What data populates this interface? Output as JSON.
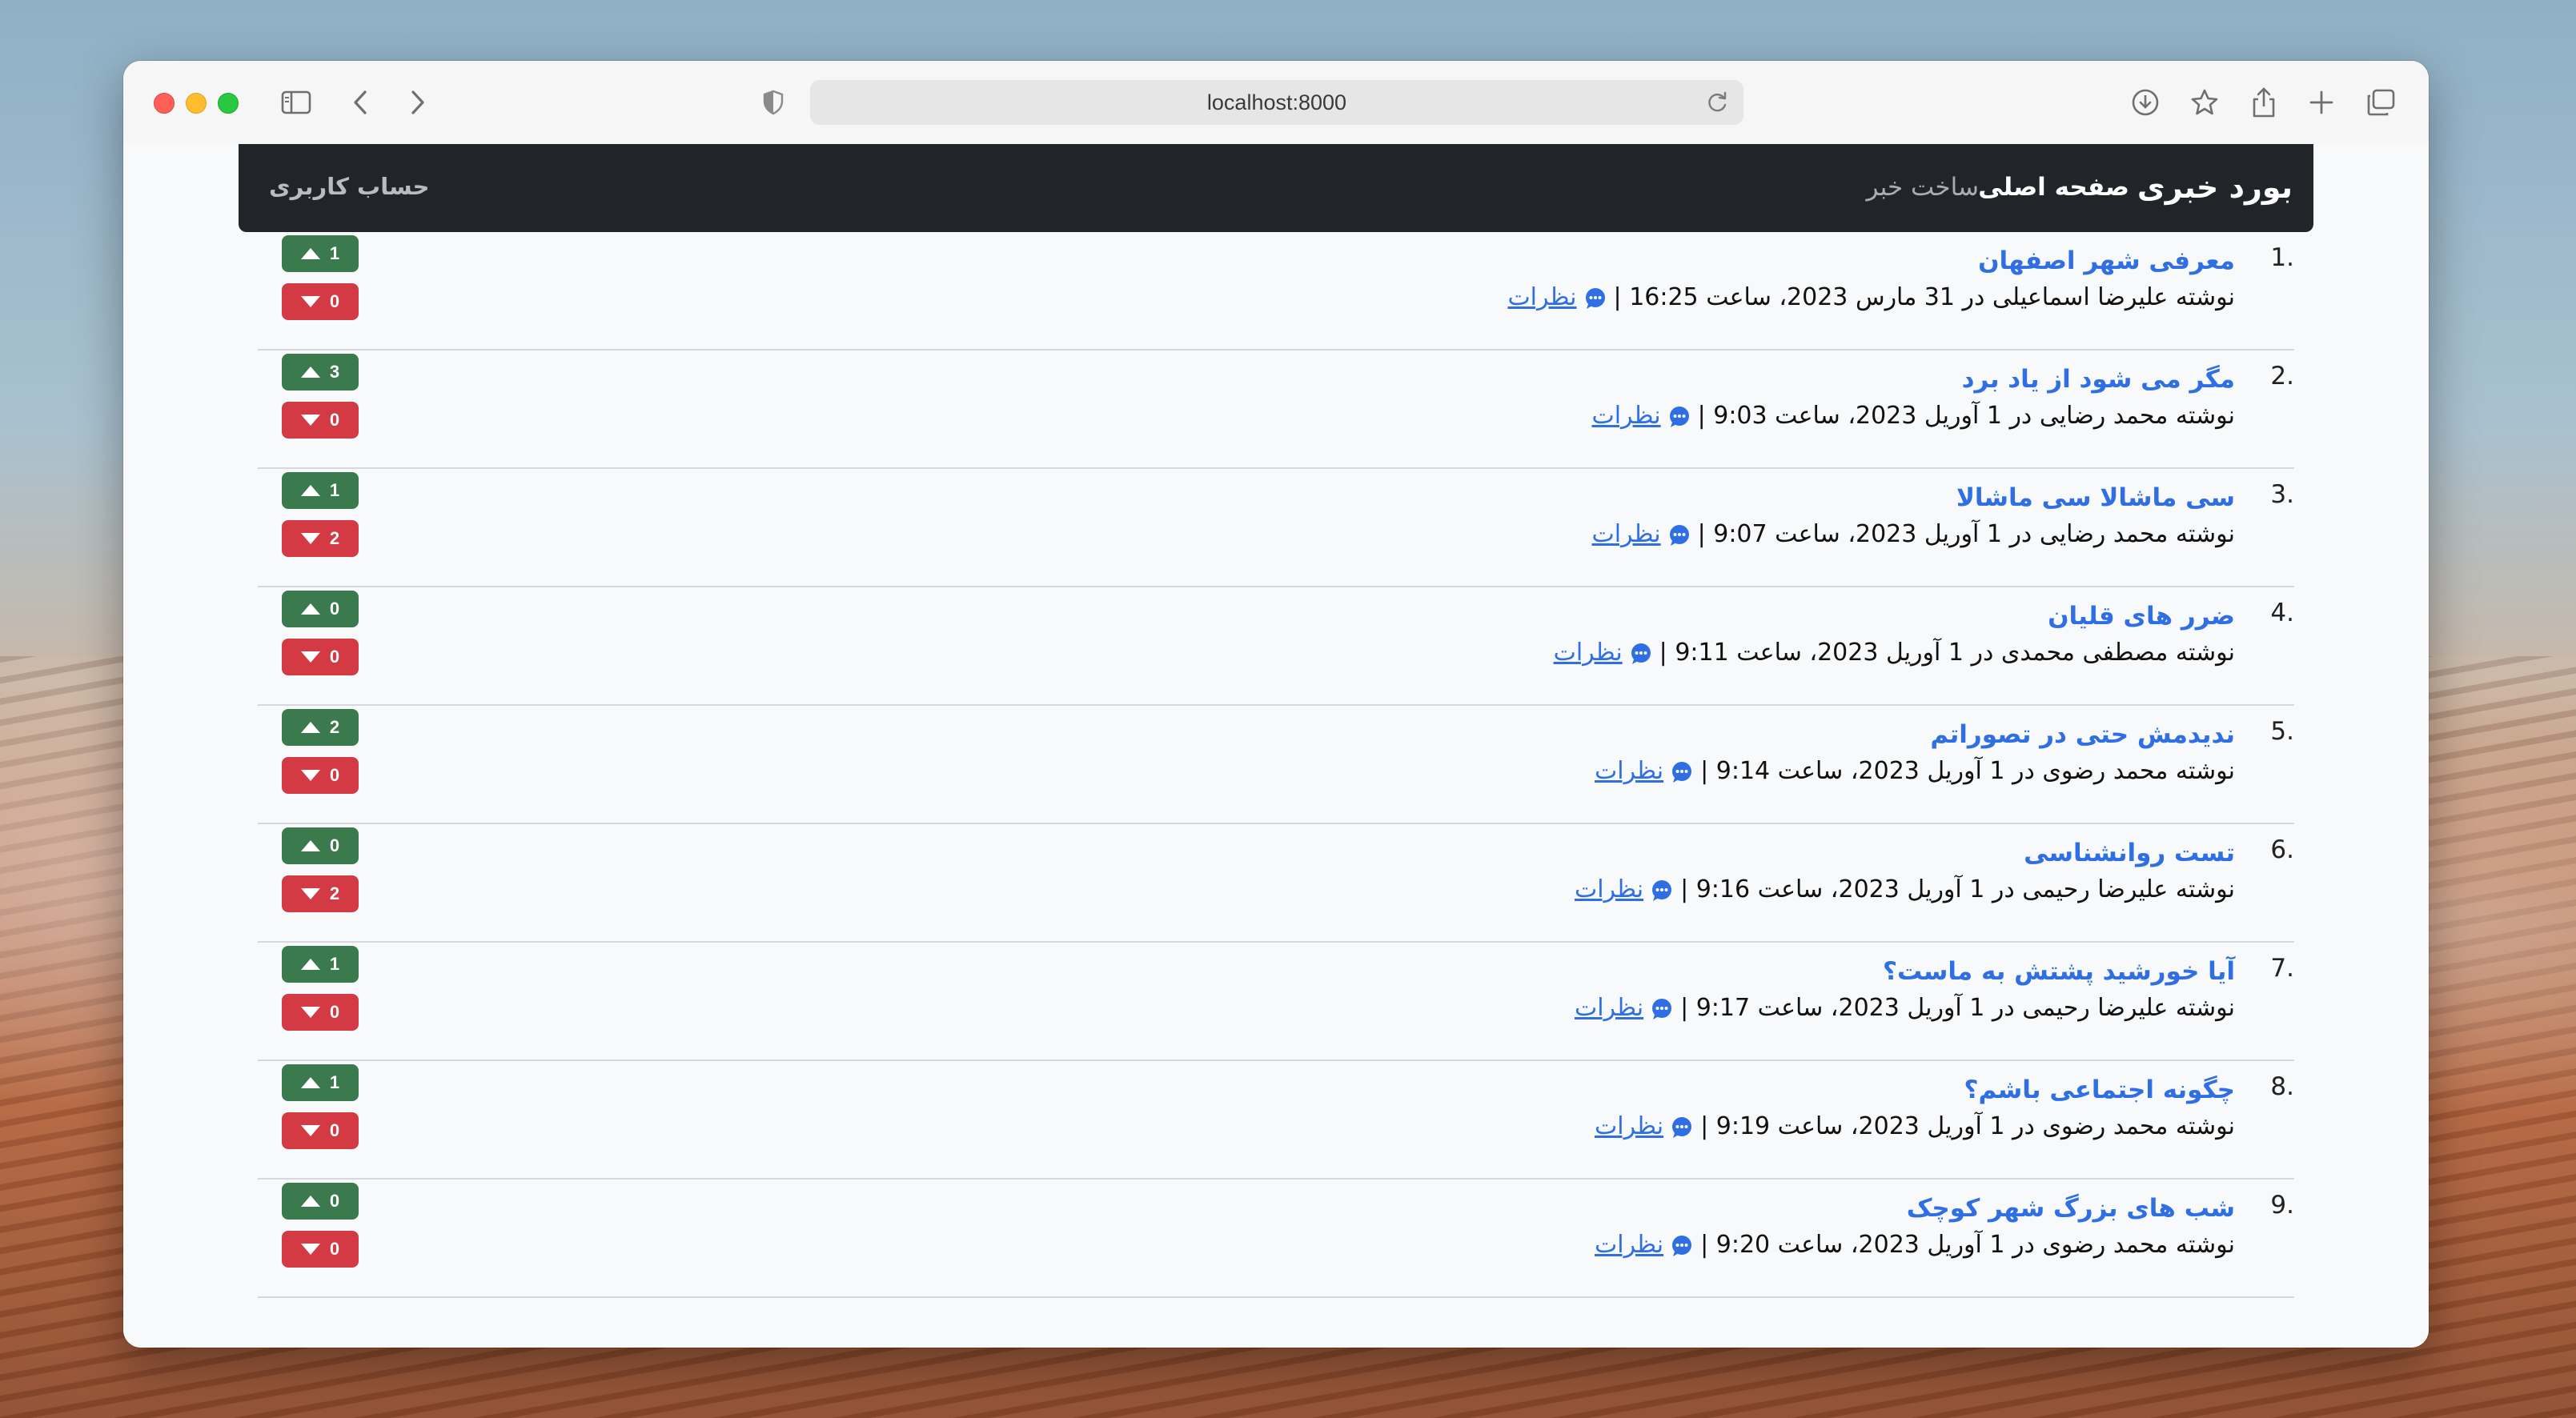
{
  "browser": {
    "url": "localhost:8000"
  },
  "navbar": {
    "brand": "بورد خبری",
    "home": "صفحه اصلی",
    "create": "ساخت خبر",
    "account": "حساب کاربری"
  },
  "colors": {
    "navbar_bg": "#212529",
    "link": "#2f6fe3",
    "upvote": "#3a7a4c",
    "downvote": "#d43a44"
  },
  "posts": [
    {
      "rank": "1.",
      "title": "معرفی شهر اصفهان",
      "meta": "نوشته علیرضا اسماعیلی در 31 مارس 2023، ساعت 16:25 |",
      "comments": "نظرات",
      "up": "1",
      "down": "0"
    },
    {
      "rank": "2.",
      "title": "مگر می شود از یاد برد",
      "meta": "نوشته محمد رضایی در 1 آوریل 2023، ساعت 9:03 |",
      "comments": "نظرات",
      "up": "3",
      "down": "0"
    },
    {
      "rank": "3.",
      "title": "سی ماشالا سی ماشالا",
      "meta": "نوشته محمد رضایی در 1 آوریل 2023، ساعت 9:07 |",
      "comments": "نظرات",
      "up": "1",
      "down": "2"
    },
    {
      "rank": "4.",
      "title": "ضرر های قلیان",
      "meta": "نوشته مصطفی محمدی در 1 آوریل 2023، ساعت 9:11 |",
      "comments": "نظرات",
      "up": "0",
      "down": "0"
    },
    {
      "rank": "5.",
      "title": "ندیدمش حتی در تصوراتم",
      "meta": "نوشته محمد رضوی در 1 آوریل 2023، ساعت 9:14 |",
      "comments": "نظرات",
      "up": "2",
      "down": "0"
    },
    {
      "rank": "6.",
      "title": "تست روانشناسی",
      "meta": "نوشته علیرضا رحیمی در 1 آوریل 2023، ساعت 9:16 |",
      "comments": "نظرات",
      "up": "0",
      "down": "2"
    },
    {
      "rank": "7.",
      "title": "آیا خورشید پشتش به ماست؟",
      "meta": "نوشته علیرضا رحیمی در 1 آوریل 2023، ساعت 9:17 |",
      "comments": "نظرات",
      "up": "1",
      "down": "0"
    },
    {
      "rank": "8.",
      "title": "چگونه اجتماعی باشم؟",
      "meta": "نوشته محمد رضوی در 1 آوریل 2023، ساعت 9:19 |",
      "comments": "نظرات",
      "up": "1",
      "down": "0"
    },
    {
      "rank": "9.",
      "title": "شب های بزرگ شهر کوچک",
      "meta": "نوشته محمد رضوی در 1 آوریل 2023، ساعت 9:20 |",
      "comments": "نظرات",
      "up": "0",
      "down": "0"
    }
  ]
}
